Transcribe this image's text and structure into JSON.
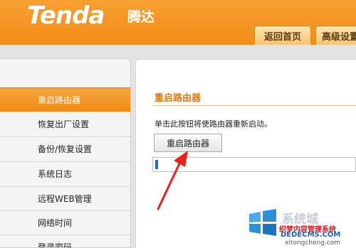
{
  "header": {
    "logo_text": "Tenda",
    "logo_cn": "腾达",
    "tabs": [
      {
        "label": "返回首页"
      },
      {
        "label": "高级设置"
      }
    ]
  },
  "sidebar": {
    "items": [
      {
        "label": "重启路由器",
        "active": true
      },
      {
        "label": "恢复出厂设置",
        "active": false
      },
      {
        "label": "备份/恢复设置",
        "active": false
      },
      {
        "label": "系统日志",
        "active": false
      },
      {
        "label": "远程WEB管理",
        "active": false
      },
      {
        "label": "网络时间",
        "active": false
      },
      {
        "label": "登录密码",
        "active": false
      }
    ]
  },
  "main": {
    "title": "重启路由器",
    "description": "单击此按钮将使路由器重新启动。",
    "reboot_button_label": "重启路由器",
    "progress_fraction": 0.01
  },
  "watermark": {
    "brand_cn": "系统城",
    "line1": "织梦内容管理系统",
    "line2": "DEDECMS.COM",
    "line3": "xitongcheng.com"
  },
  "colors": {
    "accent_orange": "#f28c17",
    "title_orange": "#e07a12",
    "progress_blue": "#1d6fb8",
    "arrow_red": "#e8231d"
  }
}
